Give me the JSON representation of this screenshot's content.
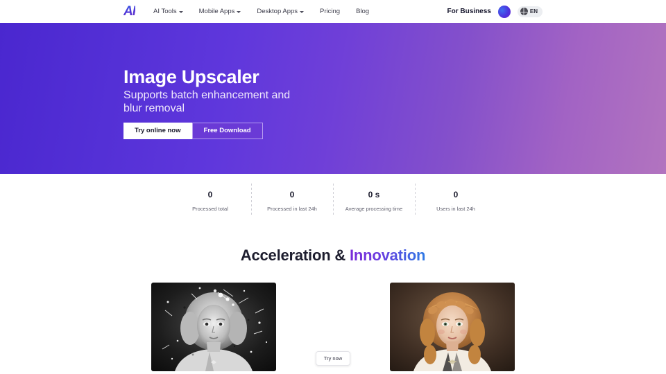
{
  "navbar": {
    "logo_text": "AI",
    "links": [
      {
        "label": "AI Tools",
        "has_caret": true
      },
      {
        "label": "Mobile Apps",
        "has_caret": true
      },
      {
        "label": "Desktop Apps",
        "has_caret": true
      },
      {
        "label": "Pricing",
        "has_caret": false
      },
      {
        "label": "Blog",
        "has_caret": false
      }
    ],
    "for_business": "For Business",
    "language": "EN"
  },
  "hero": {
    "title": "Image Upscaler",
    "subtitle": "Supports batch enhancement and blur removal",
    "primary_button": "Try online now",
    "secondary_button": "Free Download",
    "gradient_from": "#4a27cf",
    "gradient_to": "#b274bf"
  },
  "stats": [
    {
      "value": "0",
      "label": "Processed total"
    },
    {
      "value": "0",
      "label": "Processed in last 24h"
    },
    {
      "value": "0 s",
      "label": "Average processing time"
    },
    {
      "value": "0",
      "label": "Users in last 24h"
    }
  ],
  "section": {
    "title_dark": "Acceleration & ",
    "title_accent": "Innovation",
    "accent_color": "#7a2bd8"
  },
  "comparison": {
    "before_alt": "damaged-vintage-portrait-black-and-white",
    "after_alt": "restored-color-portrait",
    "try_button": "Try now"
  }
}
